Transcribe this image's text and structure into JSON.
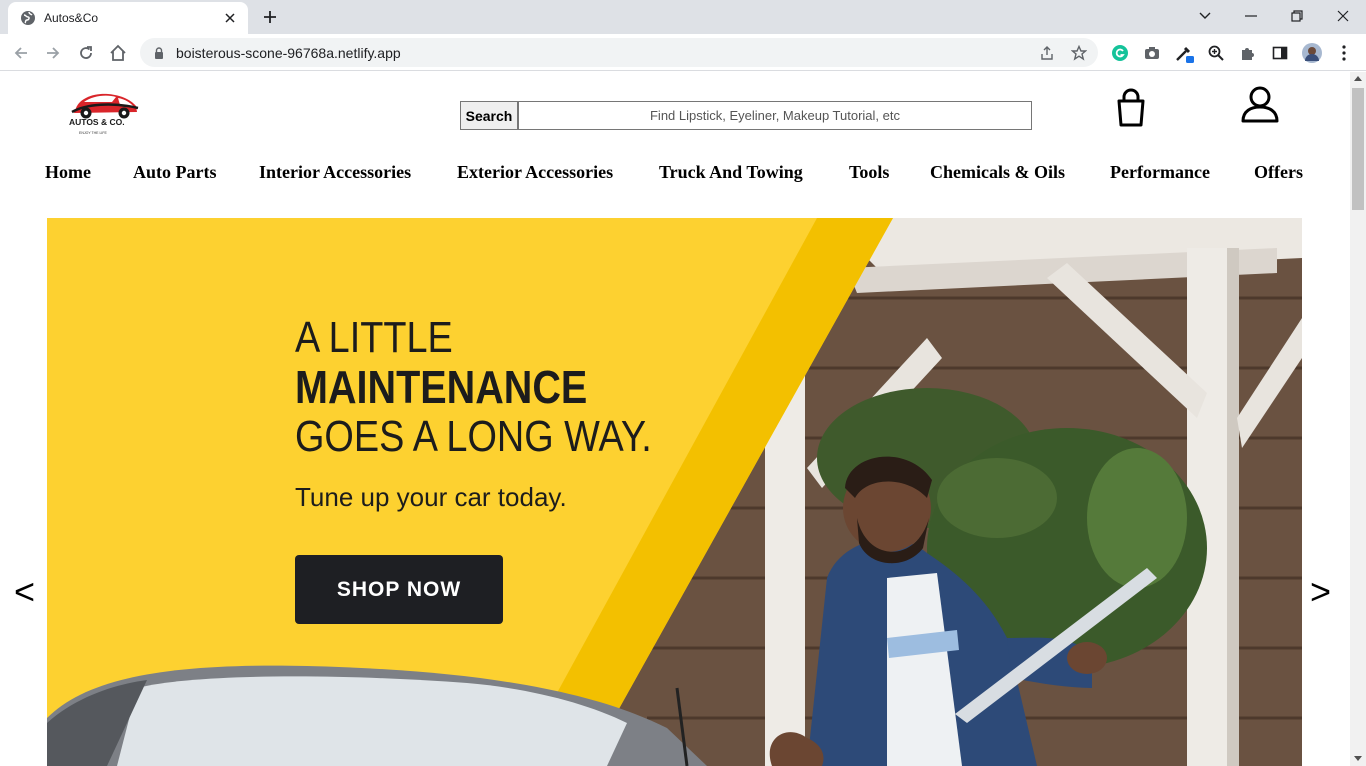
{
  "browser": {
    "tab_title": "Autos&Co",
    "url": "boisterous-scone-96768a.netlify.app"
  },
  "site": {
    "logo_text": "AUTOS & CO.",
    "logo_tagline": "ENJOY THE LIFE",
    "search_button": "Search",
    "search_placeholder": "Find Lipstick, Eyeliner, Makeup Tutorial, etc",
    "nav": [
      "Home",
      "Auto Parts",
      "Interior Accessories",
      "Exterior Accessories",
      "Truck And Towing",
      "Tools",
      "Chemicals & Oils",
      "Performance",
      "Offers"
    ]
  },
  "hero": {
    "line1": "A LITTLE",
    "line2": "MAINTENANCE",
    "line3": "GOES A LONG WAY.",
    "subtitle": "Tune up your car today.",
    "button": "SHOP NOW",
    "prev": "<",
    "next": ">"
  },
  "colors": {
    "hero_yellow": "#fdd130",
    "hero_stripe": "#f3c000",
    "button_dark": "#1e1f23",
    "logo_red": "#d9252a"
  }
}
